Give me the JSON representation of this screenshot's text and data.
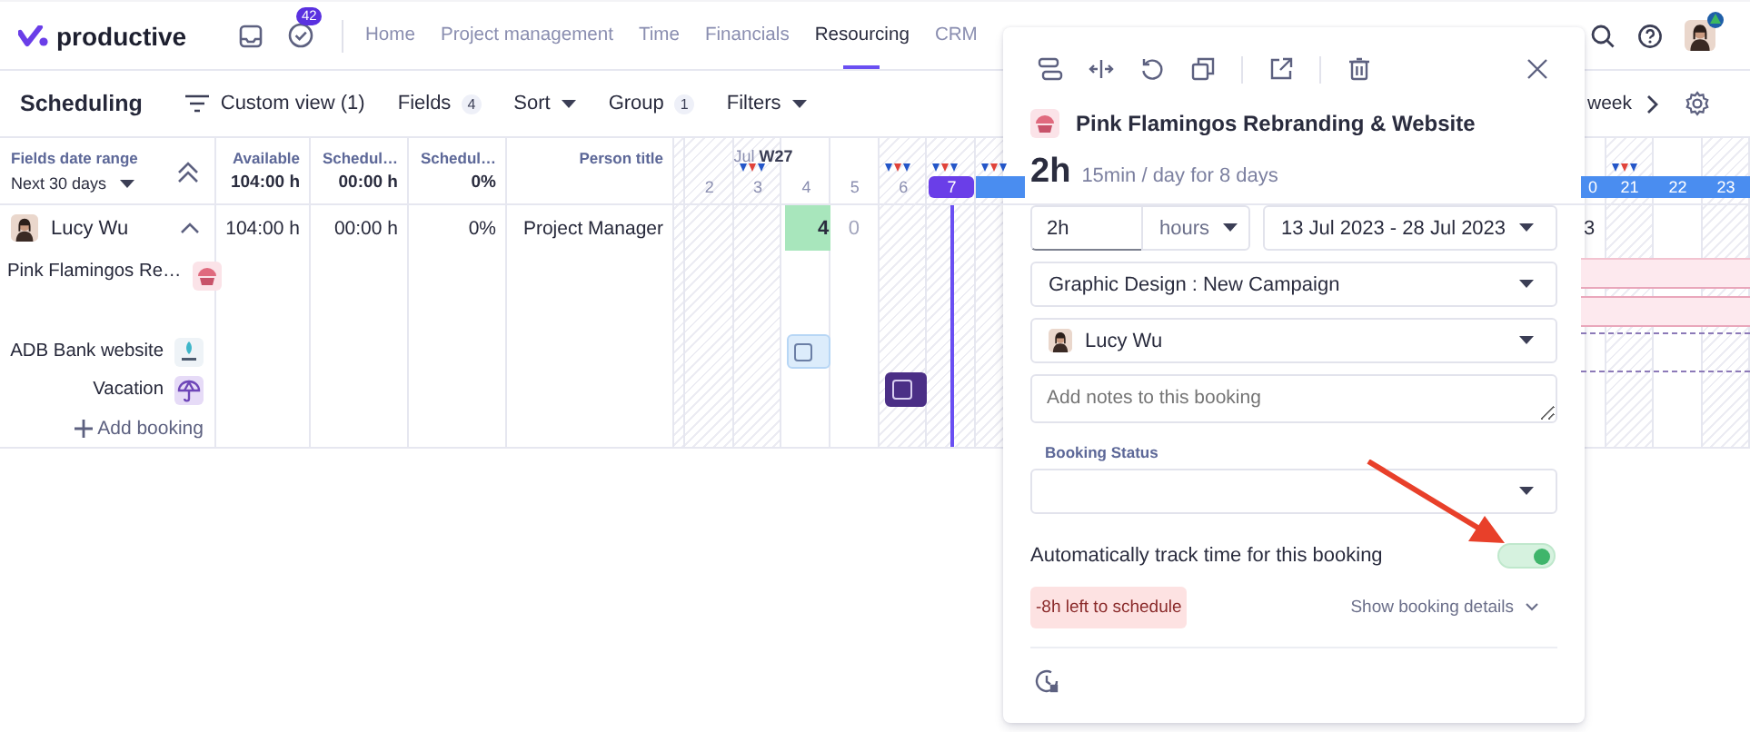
{
  "nav": {
    "logo": "productive",
    "notifications": "42",
    "tabs": [
      {
        "label": "Home",
        "selected": false
      },
      {
        "label": "Project management",
        "selected": false
      },
      {
        "label": "Time",
        "selected": false
      },
      {
        "label": "Financials",
        "selected": false
      },
      {
        "label": "Resourcing",
        "selected": true
      },
      {
        "label": "CRM",
        "selected": false
      }
    ]
  },
  "toolbar": {
    "title": "Scheduling",
    "view": "Custom view (1)",
    "fields": "Fields",
    "fields_count": "4",
    "sort": "Sort",
    "group": "Group",
    "group_count": "1",
    "filters": "Filters",
    "period": "week"
  },
  "table": {
    "range_label": "Fields date range",
    "range_value": "Next 30 days",
    "columns": [
      {
        "title": "Available",
        "total": "104:00 h"
      },
      {
        "title": "Schedul…",
        "total": "00:00 h"
      },
      {
        "title": "Schedul…",
        "total": "0%"
      },
      {
        "title": "Person title"
      }
    ]
  },
  "timeline": {
    "month": "Jul",
    "week": "W27",
    "left_days": [
      {
        "label": "2",
        "weekend": true,
        "flags": false,
        "today": false,
        "in_range": false
      },
      {
        "label": "3",
        "weekend": true,
        "flags": true,
        "today": false,
        "in_range": false
      },
      {
        "label": "4",
        "weekend": false,
        "flags": false,
        "today": false,
        "in_range": false
      },
      {
        "label": "5",
        "weekend": false,
        "flags": false,
        "today": false,
        "in_range": false
      },
      {
        "label": "6",
        "weekend": true,
        "flags": true,
        "today": false,
        "in_range": false
      },
      {
        "label": "7",
        "weekend": true,
        "flags": true,
        "today": true,
        "in_range": false
      },
      {
        "weekend": true,
        "flags": true,
        "today": false,
        "in_range": true
      }
    ],
    "right_days": [
      {
        "label": "0",
        "weekend": false,
        "flags": false,
        "today": false,
        "in_range": true
      },
      {
        "label": "21",
        "weekend": true,
        "flags": true,
        "today": false,
        "in_range": true
      },
      {
        "label": "22",
        "weekend": false,
        "flags": false,
        "today": false,
        "in_range": true
      },
      {
        "label": "23",
        "weekend": true,
        "flags": false,
        "today": false,
        "in_range": true
      }
    ]
  },
  "person": {
    "name": "Lucy Wu",
    "expanded": true,
    "values": [
      "104:00 h",
      "00:00 h",
      "0%",
      "Project Manager"
    ],
    "timeline": [
      {
        "kind": "capacity",
        "text": "4"
      },
      {
        "kind": "free",
        "text": "0"
      },
      {
        "kind": "edge",
        "text": "3"
      }
    ]
  },
  "projects": [
    {
      "name": "Pink Flamingos Re…",
      "kind": "cupcake",
      "booking": {
        "kind": "range"
      }
    },
    {
      "name": "ADB Bank website",
      "kind": "bank",
      "booking": {
        "kind": "light"
      }
    },
    {
      "name": "Vacation",
      "kind": "umbrella",
      "booking": {
        "kind": "dark"
      }
    }
  ],
  "add_booking": "Add booking",
  "popup": {
    "project": "Pink Flamingos Rebranding & Website",
    "total": "2h",
    "rate": "15min / day for 8 days",
    "amount": "2h",
    "unit": "hours",
    "dates": "13 Jul 2023 - 28 Jul 2023",
    "task": "Graphic Design : New Campaign",
    "person": "Lucy Wu",
    "notes_placeholder": "Add notes to this booking",
    "status_label": "Booking Status",
    "auto_track": {
      "label": "Automatically track time for this booking",
      "on": true
    },
    "remaining": "-8h left to schedule",
    "details": "Show booking details"
  }
}
